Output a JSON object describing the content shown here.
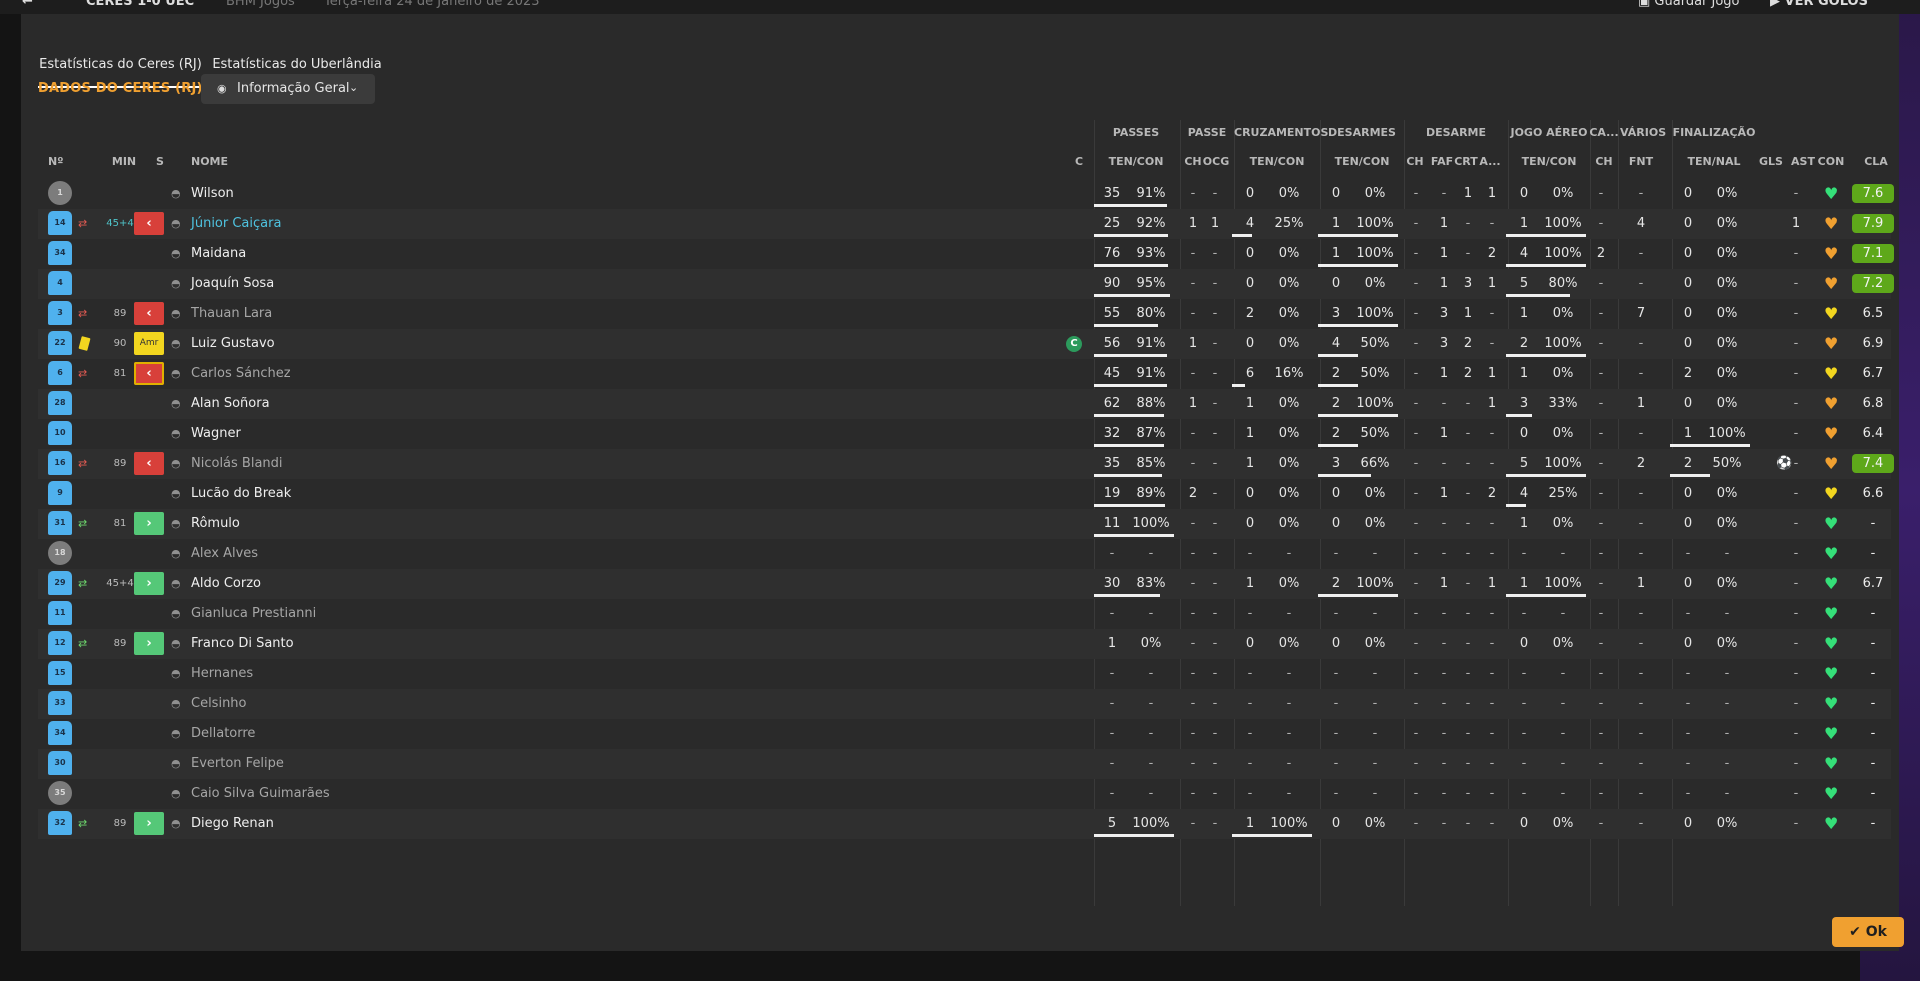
{
  "topbar": {
    "match": "CERES 1-0 UEC",
    "venue": "BHM Jogos",
    "date": "Terça-feira 24 de Janeiro de 2023",
    "save_label": "Guardar Jogo",
    "goals_label": "VER GOLOS"
  },
  "tabs": [
    "Estatísticas do Ceres (RJ)",
    "Estatísticas do Uberlândia"
  ],
  "section_title": "DADOS DO CERES (RJ)",
  "view_dropdown": "Informação Geral",
  "group_headers": [
    "PASSES",
    "PASSE",
    "CRUZAMENTOS",
    "DESARMES",
    "DESARME",
    "JOGO AÉREO",
    "CA...",
    "VÁRIOS",
    "FINALIZAÇÃO"
  ],
  "col_headers": {
    "num": "Nº",
    "min": "MIN",
    "s": "S",
    "name": "NOME",
    "c": "C",
    "pass_tc": "TEN/CON",
    "pass_ch": "CH",
    "pass_ocg": "OCG",
    "cross_tc": "TEN/CON",
    "tack_tc": "TEN/CON",
    "des_ch": "CH",
    "des_faf": "FAF",
    "des_crt": "CRT",
    "des_a": "A...",
    "air_tc": "TEN/CON",
    "ca_ch": "CH",
    "var_fnt": "FNT",
    "fin_tn": "TEN/NAL",
    "gls": "GLS",
    "ast": "AST",
    "con": "CON",
    "cla": "CLA"
  },
  "players": [
    {
      "num": "1",
      "gk": true,
      "sub": "",
      "minute": "",
      "sbtn": "",
      "name": "Wilson",
      "style": "normal",
      "captain": false,
      "pass": [
        "35",
        "91%"
      ],
      "pbar": 91,
      "pch": "-",
      "pocg": "-",
      "cross": [
        "0",
        "0%"
      ],
      "cbar": 0,
      "tack": [
        "0",
        "0%"
      ],
      "tbar": 0,
      "dch": "-",
      "dfaf": "-",
      "dcrt": "1",
      "da": "1",
      "air": [
        "0",
        "0%"
      ],
      "abar": 0,
      "cach": "-",
      "fnt": "-",
      "fin": [
        "0",
        "0%"
      ],
      "fbar": 0,
      "gls": "",
      "ast": "-",
      "con": "green",
      "cla": "7.6",
      "clahi": true
    },
    {
      "num": "14",
      "gk": false,
      "sub": "out",
      "minute": "45+4",
      "minuteBlue": true,
      "sbtn": "out",
      "name": "Júnior Caiçara",
      "style": "link",
      "captain": false,
      "pass": [
        "25",
        "92%"
      ],
      "pbar": 92,
      "pch": "1",
      "pocg": "1",
      "cross": [
        "4",
        "25%"
      ],
      "cbar": 25,
      "tack": [
        "1",
        "100%"
      ],
      "tbar": 100,
      "dch": "-",
      "dfaf": "1",
      "dcrt": "-",
      "da": "-",
      "air": [
        "1",
        "100%"
      ],
      "abar": 100,
      "cach": "-",
      "fnt": "4",
      "fin": [
        "0",
        "0%"
      ],
      "fbar": 0,
      "gls": "",
      "ast": "1",
      "con": "orange",
      "cla": "7.9",
      "clahi": true
    },
    {
      "num": "34",
      "gk": false,
      "sub": "",
      "minute": "",
      "sbtn": "",
      "name": "Maidana",
      "style": "normal",
      "captain": false,
      "pass": [
        "76",
        "93%"
      ],
      "pbar": 93,
      "pch": "-",
      "pocg": "-",
      "cross": [
        "0",
        "0%"
      ],
      "cbar": 0,
      "tack": [
        "1",
        "100%"
      ],
      "tbar": 100,
      "dch": "-",
      "dfaf": "1",
      "dcrt": "-",
      "da": "2",
      "air": [
        "4",
        "100%"
      ],
      "abar": 100,
      "cach": "2",
      "fnt": "-",
      "fin": [
        "0",
        "0%"
      ],
      "fbar": 0,
      "gls": "",
      "ast": "-",
      "con": "orange",
      "cla": "7.1",
      "clahi": true
    },
    {
      "num": "4",
      "gk": false,
      "sub": "",
      "minute": "",
      "sbtn": "",
      "name": "Joaquín Sosa",
      "style": "normal",
      "captain": false,
      "pass": [
        "90",
        "95%"
      ],
      "pbar": 95,
      "pch": "-",
      "pocg": "-",
      "cross": [
        "0",
        "0%"
      ],
      "cbar": 0,
      "tack": [
        "0",
        "0%"
      ],
      "tbar": 0,
      "dch": "-",
      "dfaf": "1",
      "dcrt": "3",
      "da": "1",
      "air": [
        "5",
        "80%"
      ],
      "abar": 80,
      "cach": "-",
      "fnt": "-",
      "fin": [
        "0",
        "0%"
      ],
      "fbar": 0,
      "gls": "",
      "ast": "-",
      "con": "orange",
      "cla": "7.2",
      "clahi": true
    },
    {
      "num": "3",
      "gk": false,
      "sub": "out",
      "minute": "89",
      "sbtn": "out",
      "name": "Thauan Lara",
      "style": "dim",
      "captain": false,
      "pass": [
        "55",
        "80%"
      ],
      "pbar": 80,
      "pch": "-",
      "pocg": "-",
      "cross": [
        "2",
        "0%"
      ],
      "cbar": 0,
      "tack": [
        "3",
        "100%"
      ],
      "tbar": 100,
      "dch": "-",
      "dfaf": "3",
      "dcrt": "1",
      "da": "-",
      "air": [
        "1",
        "0%"
      ],
      "abar": 0,
      "cach": "-",
      "fnt": "7",
      "fin": [
        "0",
        "0%"
      ],
      "fbar": 0,
      "gls": "",
      "ast": "-",
      "con": "yellow",
      "cla": "6.5",
      "clahi": false
    },
    {
      "num": "22",
      "gk": false,
      "sub": "card",
      "minute": "90",
      "sbtn": "amr",
      "name": "Luiz Gustavo",
      "style": "normal",
      "captain": true,
      "pass": [
        "56",
        "91%"
      ],
      "pbar": 91,
      "pch": "1",
      "pocg": "-",
      "cross": [
        "0",
        "0%"
      ],
      "cbar": 0,
      "tack": [
        "4",
        "50%"
      ],
      "tbar": 50,
      "dch": "-",
      "dfaf": "3",
      "dcrt": "2",
      "da": "-",
      "air": [
        "2",
        "100%"
      ],
      "abar": 100,
      "cach": "-",
      "fnt": "-",
      "fin": [
        "0",
        "0%"
      ],
      "fbar": 0,
      "gls": "",
      "ast": "-",
      "con": "orange",
      "cla": "6.9",
      "clahi": false
    },
    {
      "num": "6",
      "gk": false,
      "sub": "out",
      "minute": "81",
      "sbtn": "outy",
      "name": "Carlos Sánchez",
      "style": "dim",
      "captain": false,
      "pass": [
        "45",
        "91%"
      ],
      "pbar": 91,
      "pch": "-",
      "pocg": "-",
      "cross": [
        "6",
        "16%"
      ],
      "cbar": 16,
      "tack": [
        "2",
        "50%"
      ],
      "tbar": 50,
      "dch": "-",
      "dfaf": "1",
      "dcrt": "2",
      "da": "1",
      "air": [
        "1",
        "0%"
      ],
      "abar": 0,
      "cach": "-",
      "fnt": "-",
      "fin": [
        "2",
        "0%"
      ],
      "fbar": 0,
      "gls": "",
      "ast": "-",
      "con": "yellow",
      "cla": "6.7",
      "clahi": false
    },
    {
      "num": "28",
      "gk": false,
      "sub": "",
      "minute": "",
      "sbtn": "",
      "name": "Alan Soñora",
      "style": "normal",
      "captain": false,
      "pass": [
        "62",
        "88%"
      ],
      "pbar": 88,
      "pch": "1",
      "pocg": "-",
      "cross": [
        "1",
        "0%"
      ],
      "cbar": 0,
      "tack": [
        "2",
        "100%"
      ],
      "tbar": 100,
      "dch": "-",
      "dfaf": "-",
      "dcrt": "-",
      "da": "1",
      "air": [
        "3",
        "33%"
      ],
      "abar": 33,
      "cach": "-",
      "fnt": "1",
      "fin": [
        "0",
        "0%"
      ],
      "fbar": 0,
      "gls": "",
      "ast": "-",
      "con": "orange",
      "cla": "6.8",
      "clahi": false
    },
    {
      "num": "10",
      "gk": false,
      "sub": "",
      "minute": "",
      "sbtn": "",
      "name": "Wagner",
      "style": "normal",
      "captain": false,
      "pass": [
        "32",
        "87%"
      ],
      "pbar": 87,
      "pch": "-",
      "pocg": "-",
      "cross": [
        "1",
        "0%"
      ],
      "cbar": 0,
      "tack": [
        "2",
        "50%"
      ],
      "tbar": 50,
      "dch": "-",
      "dfaf": "1",
      "dcrt": "-",
      "da": "-",
      "air": [
        "0",
        "0%"
      ],
      "abar": 0,
      "cach": "-",
      "fnt": "-",
      "fin": [
        "1",
        "100%"
      ],
      "fbar": 100,
      "gls": "",
      "ast": "-",
      "con": "orange",
      "cla": "6.4",
      "clahi": false
    },
    {
      "num": "16",
      "gk": false,
      "sub": "out",
      "minute": "89",
      "sbtn": "out",
      "name": "Nicolás Blandi",
      "style": "dim",
      "captain": false,
      "pass": [
        "35",
        "85%"
      ],
      "pbar": 85,
      "pch": "-",
      "pocg": "-",
      "cross": [
        "1",
        "0%"
      ],
      "cbar": 0,
      "tack": [
        "3",
        "66%"
      ],
      "tbar": 66,
      "dch": "-",
      "dfaf": "-",
      "dcrt": "-",
      "da": "-",
      "air": [
        "5",
        "100%"
      ],
      "abar": 100,
      "cach": "-",
      "fnt": "2",
      "fin": [
        "2",
        "50%"
      ],
      "fbar": 50,
      "gls": "⚽",
      "ast": "-",
      "con": "orange",
      "cla": "7.4",
      "clahi": true
    },
    {
      "num": "9",
      "gk": false,
      "sub": "",
      "minute": "",
      "sbtn": "",
      "name": "Lucão do Break",
      "style": "normal",
      "captain": false,
      "pass": [
        "19",
        "89%"
      ],
      "pbar": 89,
      "pch": "2",
      "pocg": "-",
      "cross": [
        "0",
        "0%"
      ],
      "cbar": 0,
      "tack": [
        "0",
        "0%"
      ],
      "tbar": 0,
      "dch": "-",
      "dfaf": "1",
      "dcrt": "-",
      "da": "2",
      "air": [
        "4",
        "25%"
      ],
      "abar": 25,
      "cach": "-",
      "fnt": "-",
      "fin": [
        "0",
        "0%"
      ],
      "fbar": 0,
      "gls": "",
      "ast": "-",
      "con": "yellow",
      "cla": "6.6",
      "clahi": false
    },
    {
      "num": "31",
      "gk": false,
      "sub": "in",
      "minute": "81",
      "sbtn": "in",
      "name": "Rômulo",
      "style": "normal",
      "captain": false,
      "pass": [
        "11",
        "100%"
      ],
      "pbar": 100,
      "pch": "-",
      "pocg": "-",
      "cross": [
        "0",
        "0%"
      ],
      "cbar": 0,
      "tack": [
        "0",
        "0%"
      ],
      "tbar": 0,
      "dch": "-",
      "dfaf": "-",
      "dcrt": "-",
      "da": "-",
      "air": [
        "1",
        "0%"
      ],
      "abar": 0,
      "cach": "-",
      "fnt": "-",
      "fin": [
        "0",
        "0%"
      ],
      "fbar": 0,
      "gls": "",
      "ast": "-",
      "con": "green",
      "cla": "-",
      "clahi": false
    },
    {
      "num": "18",
      "gk": true,
      "sub": "",
      "minute": "",
      "sbtn": "",
      "name": "Alex Alves",
      "style": "dim",
      "captain": false,
      "pass": [
        "-",
        "-"
      ],
      "pbar": 0,
      "pch": "-",
      "pocg": "-",
      "cross": [
        "-",
        "-"
      ],
      "cbar": 0,
      "tack": [
        "-",
        "-"
      ],
      "tbar": 0,
      "dch": "-",
      "dfaf": "-",
      "dcrt": "-",
      "da": "-",
      "air": [
        "-",
        "-"
      ],
      "abar": 0,
      "cach": "-",
      "fnt": "-",
      "fin": [
        "-",
        "-"
      ],
      "fbar": 0,
      "gls": "",
      "ast": "-",
      "con": "green",
      "cla": "-",
      "clahi": false
    },
    {
      "num": "29",
      "gk": false,
      "sub": "in",
      "minute": "45+4",
      "sbtn": "in",
      "name": "Aldo Corzo",
      "style": "normal",
      "captain": false,
      "pass": [
        "30",
        "83%"
      ],
      "pbar": 83,
      "pch": "-",
      "pocg": "-",
      "cross": [
        "1",
        "0%"
      ],
      "cbar": 0,
      "tack": [
        "2",
        "100%"
      ],
      "tbar": 100,
      "dch": "-",
      "dfaf": "1",
      "dcrt": "-",
      "da": "1",
      "air": [
        "1",
        "100%"
      ],
      "abar": 100,
      "cach": "-",
      "fnt": "1",
      "fin": [
        "0",
        "0%"
      ],
      "fbar": 0,
      "gls": "",
      "ast": "-",
      "con": "green",
      "cla": "6.7",
      "clahi": false
    },
    {
      "num": "11",
      "gk": false,
      "sub": "",
      "minute": "",
      "sbtn": "",
      "name": "Gianluca Prestianni",
      "style": "dim",
      "captain": false,
      "pass": [
        "-",
        "-"
      ],
      "pbar": 0,
      "pch": "-",
      "pocg": "-",
      "cross": [
        "-",
        "-"
      ],
      "cbar": 0,
      "tack": [
        "-",
        "-"
      ],
      "tbar": 0,
      "dch": "-",
      "dfaf": "-",
      "dcrt": "-",
      "da": "-",
      "air": [
        "-",
        "-"
      ],
      "abar": 0,
      "cach": "-",
      "fnt": "-",
      "fin": [
        "-",
        "-"
      ],
      "fbar": 0,
      "gls": "",
      "ast": "-",
      "con": "green",
      "cla": "-",
      "clahi": false
    },
    {
      "num": "12",
      "gk": false,
      "sub": "in",
      "minute": "89",
      "sbtn": "in",
      "name": "Franco Di Santo",
      "style": "normal",
      "captain": false,
      "pass": [
        "1",
        "0%"
      ],
      "pbar": 0,
      "pch": "-",
      "pocg": "-",
      "cross": [
        "0",
        "0%"
      ],
      "cbar": 0,
      "tack": [
        "0",
        "0%"
      ],
      "tbar": 0,
      "dch": "-",
      "dfaf": "-",
      "dcrt": "-",
      "da": "-",
      "air": [
        "0",
        "0%"
      ],
      "abar": 0,
      "cach": "-",
      "fnt": "-",
      "fin": [
        "0",
        "0%"
      ],
      "fbar": 0,
      "gls": "",
      "ast": "-",
      "con": "green",
      "cla": "-",
      "clahi": false
    },
    {
      "num": "15",
      "gk": false,
      "sub": "",
      "minute": "",
      "sbtn": "",
      "name": "Hernanes",
      "style": "dim",
      "captain": false,
      "pass": [
        "-",
        "-"
      ],
      "pbar": 0,
      "pch": "-",
      "pocg": "-",
      "cross": [
        "-",
        "-"
      ],
      "cbar": 0,
      "tack": [
        "-",
        "-"
      ],
      "tbar": 0,
      "dch": "-",
      "dfaf": "-",
      "dcrt": "-",
      "da": "-",
      "air": [
        "-",
        "-"
      ],
      "abar": 0,
      "cach": "-",
      "fnt": "-",
      "fin": [
        "-",
        "-"
      ],
      "fbar": 0,
      "gls": "",
      "ast": "-",
      "con": "green",
      "cla": "-",
      "clahi": false
    },
    {
      "num": "33",
      "gk": false,
      "sub": "",
      "minute": "",
      "sbtn": "",
      "name": "Celsinho",
      "style": "dim",
      "captain": false,
      "pass": [
        "-",
        "-"
      ],
      "pbar": 0,
      "pch": "-",
      "pocg": "-",
      "cross": [
        "-",
        "-"
      ],
      "cbar": 0,
      "tack": [
        "-",
        "-"
      ],
      "tbar": 0,
      "dch": "-",
      "dfaf": "-",
      "dcrt": "-",
      "da": "-",
      "air": [
        "-",
        "-"
      ],
      "abar": 0,
      "cach": "-",
      "fnt": "-",
      "fin": [
        "-",
        "-"
      ],
      "fbar": 0,
      "gls": "",
      "ast": "-",
      "con": "green",
      "cla": "-",
      "clahi": false
    },
    {
      "num": "34",
      "gk": false,
      "sub": "",
      "minute": "",
      "sbtn": "",
      "name": "Dellatorre",
      "style": "dim",
      "captain": false,
      "pass": [
        "-",
        "-"
      ],
      "pbar": 0,
      "pch": "-",
      "pocg": "-",
      "cross": [
        "-",
        "-"
      ],
      "cbar": 0,
      "tack": [
        "-",
        "-"
      ],
      "tbar": 0,
      "dch": "-",
      "dfaf": "-",
      "dcrt": "-",
      "da": "-",
      "air": [
        "-",
        "-"
      ],
      "abar": 0,
      "cach": "-",
      "fnt": "-",
      "fin": [
        "-",
        "-"
      ],
      "fbar": 0,
      "gls": "",
      "ast": "-",
      "con": "green",
      "cla": "-",
      "clahi": false
    },
    {
      "num": "30",
      "gk": false,
      "sub": "",
      "minute": "",
      "sbtn": "",
      "name": "Everton Felipe",
      "style": "dim",
      "captain": false,
      "pass": [
        "-",
        "-"
      ],
      "pbar": 0,
      "pch": "-",
      "pocg": "-",
      "cross": [
        "-",
        "-"
      ],
      "cbar": 0,
      "tack": [
        "-",
        "-"
      ],
      "tbar": 0,
      "dch": "-",
      "dfaf": "-",
      "dcrt": "-",
      "da": "-",
      "air": [
        "-",
        "-"
      ],
      "abar": 0,
      "cach": "-",
      "fnt": "-",
      "fin": [
        "-",
        "-"
      ],
      "fbar": 0,
      "gls": "",
      "ast": "-",
      "con": "green",
      "cla": "-",
      "clahi": false
    },
    {
      "num": "35",
      "gk": true,
      "sub": "",
      "minute": "",
      "sbtn": "",
      "name": "Caio Silva Guimarães",
      "style": "dim",
      "captain": false,
      "pass": [
        "-",
        "-"
      ],
      "pbar": 0,
      "pch": "-",
      "pocg": "-",
      "cross": [
        "-",
        "-"
      ],
      "cbar": 0,
      "tack": [
        "-",
        "-"
      ],
      "tbar": 0,
      "dch": "-",
      "dfaf": "-",
      "dcrt": "-",
      "da": "-",
      "air": [
        "-",
        "-"
      ],
      "abar": 0,
      "cach": "-",
      "fnt": "-",
      "fin": [
        "-",
        "-"
      ],
      "fbar": 0,
      "gls": "",
      "ast": "-",
      "con": "green",
      "cla": "-",
      "clahi": false
    },
    {
      "num": "32",
      "gk": false,
      "sub": "in",
      "minute": "89",
      "sbtn": "in",
      "name": "Diego Renan",
      "style": "normal",
      "captain": false,
      "pass": [
        "5",
        "100%"
      ],
      "pbar": 100,
      "pch": "-",
      "pocg": "-",
      "cross": [
        "1",
        "100%"
      ],
      "cbar": 100,
      "tack": [
        "0",
        "0%"
      ],
      "tbar": 0,
      "dch": "-",
      "dfaf": "-",
      "dcrt": "-",
      "da": "-",
      "air": [
        "0",
        "0%"
      ],
      "abar": 0,
      "cach": "-",
      "fnt": "-",
      "fin": [
        "0",
        "0%"
      ],
      "fbar": 0,
      "gls": "",
      "ast": "-",
      "con": "green",
      "cla": "-",
      "clahi": false
    }
  ],
  "captain_badge": "C",
  "amr_label": "Amr",
  "ok_label": "Ok"
}
